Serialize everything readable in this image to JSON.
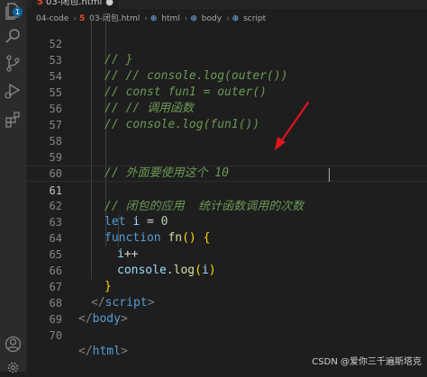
{
  "tab": {
    "filename": "03-闭包.html",
    "dirty_marker": "●"
  },
  "breadcrumb": {
    "folder": "04-code",
    "file": "03-闭包.html",
    "html": "html",
    "body": "body",
    "script": "script"
  },
  "editor": {
    "current_line": "61",
    "lines": [
      {
        "num": "52",
        "code": "// }"
      },
      {
        "num": "53",
        "code": "// // console.log(outer())"
      },
      {
        "num": "54",
        "code": "// const fun1 = outer()"
      },
      {
        "num": "55",
        "code": "// // 调用函数"
      },
      {
        "num": "56",
        "code": "// console.log(fun1())"
      },
      {
        "num": "57",
        "code": ""
      },
      {
        "num": "58",
        "code": ""
      },
      {
        "num": "59",
        "code": "// 外面要使用这个 10"
      },
      {
        "num": "60",
        "code": ""
      },
      {
        "num": "61",
        "code": "// 闭包的应用  统计函数调用的次数"
      },
      {
        "num": "62",
        "kw": "let",
        "var": "i",
        "op": "=",
        "num_val": "0"
      },
      {
        "num": "63",
        "kw": "function",
        "fn": "fn",
        "parens": "()",
        "brace": "{"
      },
      {
        "num": "64",
        "var": "i",
        "op": "++"
      },
      {
        "num": "65",
        "obj": "console",
        "dot": ".",
        "fn": "log",
        "open": "(",
        "var": "i",
        "close": ")"
      },
      {
        "num": "66",
        "brace": "}"
      },
      {
        "num": "67",
        "tag": "script"
      },
      {
        "num": "68",
        "tag": "body"
      },
      {
        "num": "69",
        "code": ""
      },
      {
        "num": "70",
        "tag": "html"
      }
    ]
  },
  "watermark": "CSDN @爱你三千遍斯塔克",
  "activity_icons": [
    "explorer-icon",
    "search-icon",
    "source-control-icon",
    "run-debug-icon",
    "extensions-icon",
    "account-icon",
    "settings-gear-icon"
  ],
  "badge": "1",
  "colors": {
    "comment": "#6a9955",
    "keyword": "#569cd6",
    "variable": "#9cdcfe",
    "number": "#b5cea8",
    "function": "#dcdcaa",
    "arrow": "#e0141e"
  }
}
